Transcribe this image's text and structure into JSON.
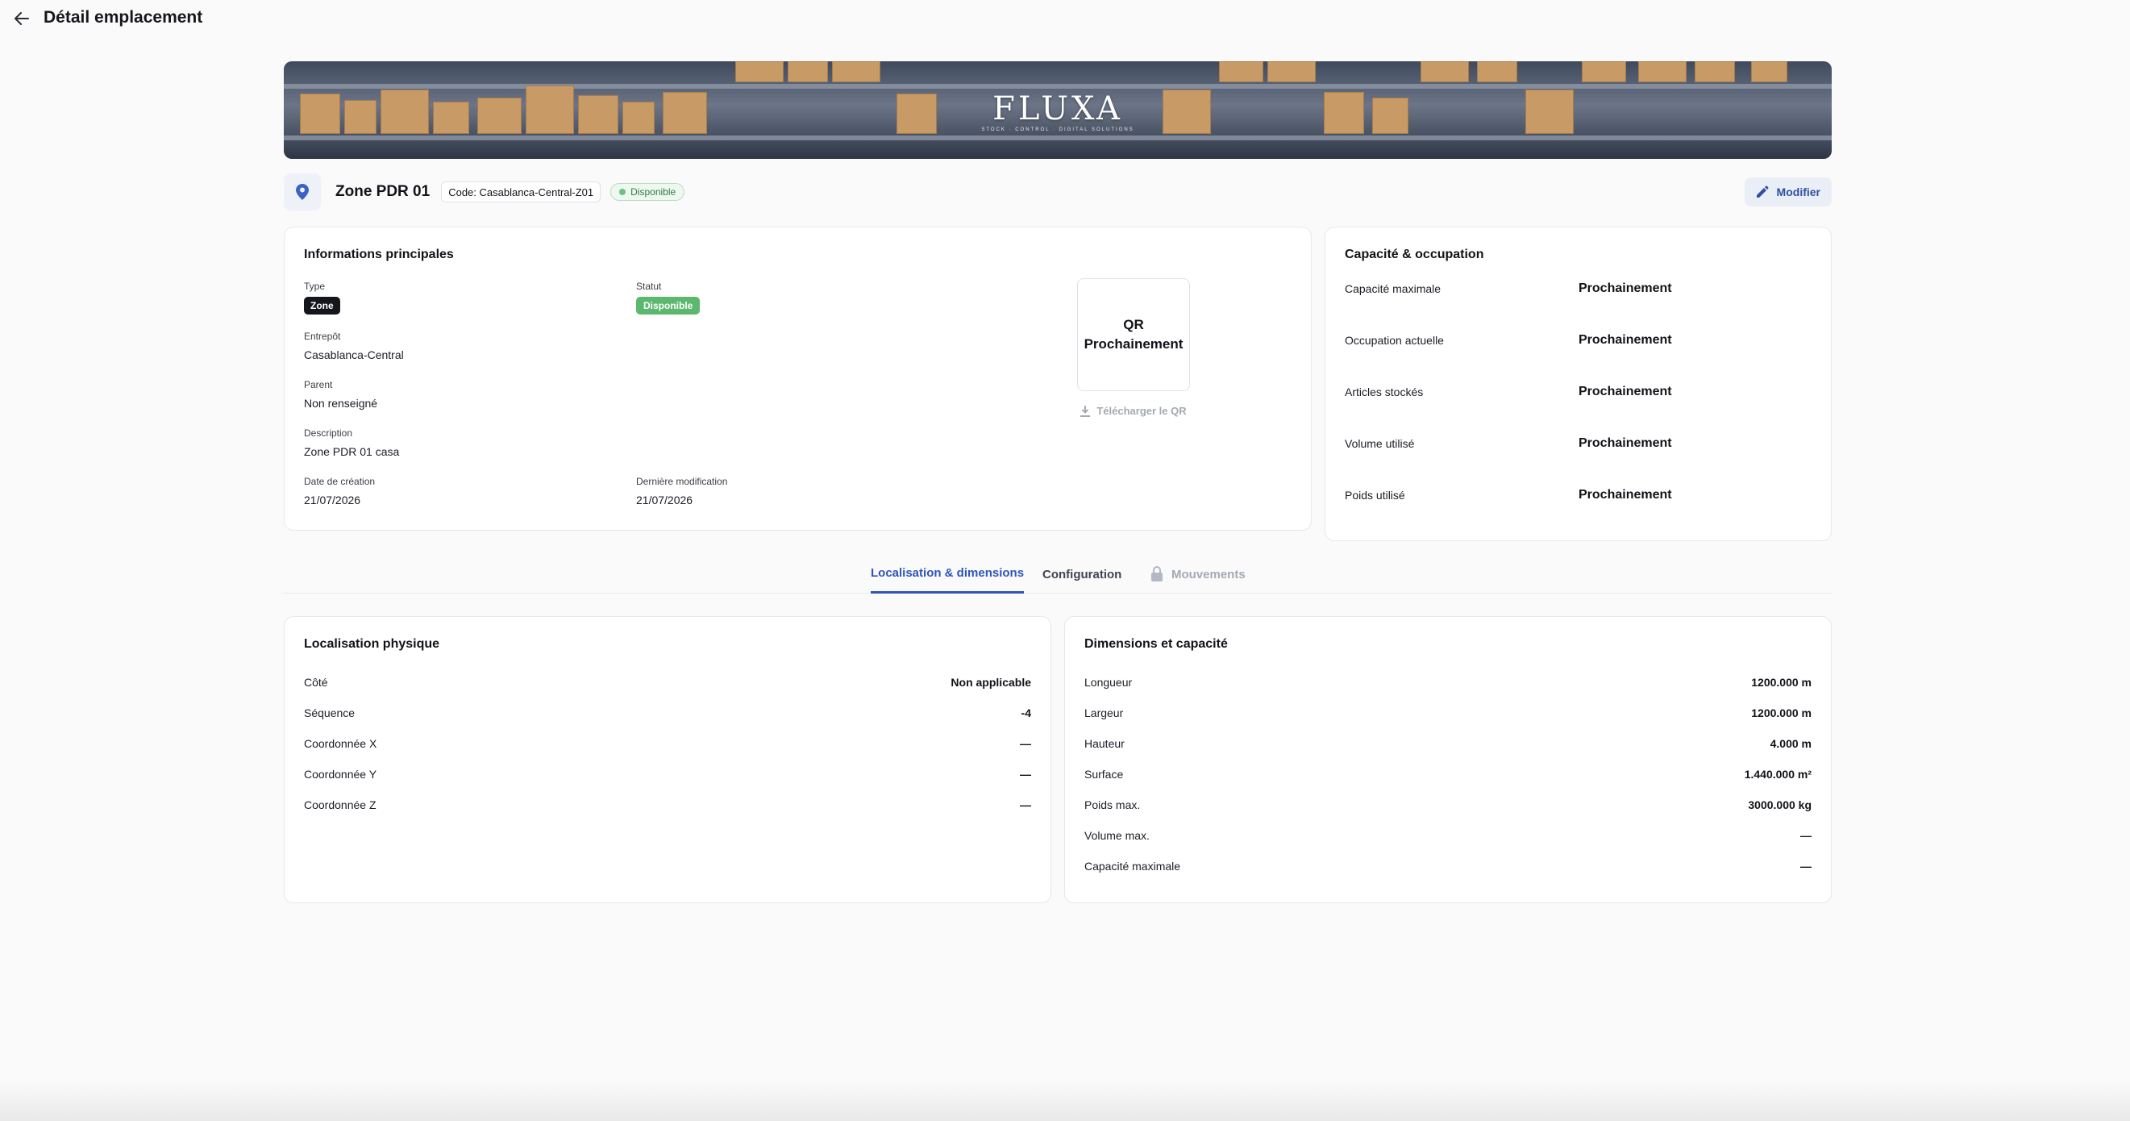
{
  "header": {
    "title": "Détail emplacement",
    "back_icon": "arrow-left-icon"
  },
  "banner": {
    "logo_text": "FLUXA",
    "tagline": "STOCK · CONTROL · DIGITAL SOLUTIONS"
  },
  "location": {
    "name": "Zone PDR 01",
    "code": "Code: Casablanca-Central-Z01",
    "status": "Disponible",
    "edit_label": "Modifier"
  },
  "info": {
    "title": "Informations principales",
    "type_label": "Type",
    "type_value": "Zone",
    "statut_label": "Statut",
    "statut_value": "Disponible",
    "entrepot_label": "Entrepôt",
    "entrepot_value": "Casablanca-Central",
    "parent_label": "Parent",
    "parent_value": "Non renseigné",
    "description_label": "Description",
    "description_value": "Zone PDR 01 casa",
    "creation_label": "Date de création",
    "creation_value": "21/07/2026",
    "modification_label": "Dernière modification",
    "modification_value": "21/07/2026",
    "qr_line1": "QR",
    "qr_line2": "Prochainement",
    "qr_download": "Télécharger le QR"
  },
  "capacity": {
    "title": "Capacité & occupation",
    "rows": [
      {
        "label": "Capacité maximale",
        "value": "Prochainement"
      },
      {
        "label": "Occupation actuelle",
        "value": "Prochainement"
      },
      {
        "label": "Articles stockés",
        "value": "Prochainement"
      },
      {
        "label": "Volume utilisé",
        "value": "Prochainement"
      },
      {
        "label": "Poids utilisé",
        "value": "Prochainement"
      }
    ]
  },
  "tabs": [
    {
      "label": "Localisation & dimensions",
      "state": "active"
    },
    {
      "label": "Configuration",
      "state": "normal"
    },
    {
      "label": "Mouvements",
      "state": "disabled"
    }
  ],
  "localisation": {
    "title": "Localisation physique",
    "rows": [
      {
        "label": "Côté",
        "value": "Non applicable"
      },
      {
        "label": "Séquence",
        "value": "-4"
      },
      {
        "label": "Coordonnée X",
        "value": "—"
      },
      {
        "label": "Coordonnée Y",
        "value": "—"
      },
      {
        "label": "Coordonnée Z",
        "value": "—"
      }
    ]
  },
  "dimensions": {
    "title": "Dimensions et capacité",
    "rows": [
      {
        "label": "Longueur",
        "value": "1200.000 m"
      },
      {
        "label": "Largeur",
        "value": "1200.000 m"
      },
      {
        "label": "Hauteur",
        "value": "4.000 m"
      },
      {
        "label": "Surface",
        "value": "1.440.000 m²"
      },
      {
        "label": "Poids max.",
        "value": "3000.000 kg"
      },
      {
        "label": "Volume max.",
        "value": "—"
      },
      {
        "label": "Capacité maximale",
        "value": "—"
      }
    ]
  },
  "colors": {
    "accent": "#2f55b8",
    "success": "#5cb86f",
    "dark_badge": "#14161b"
  }
}
